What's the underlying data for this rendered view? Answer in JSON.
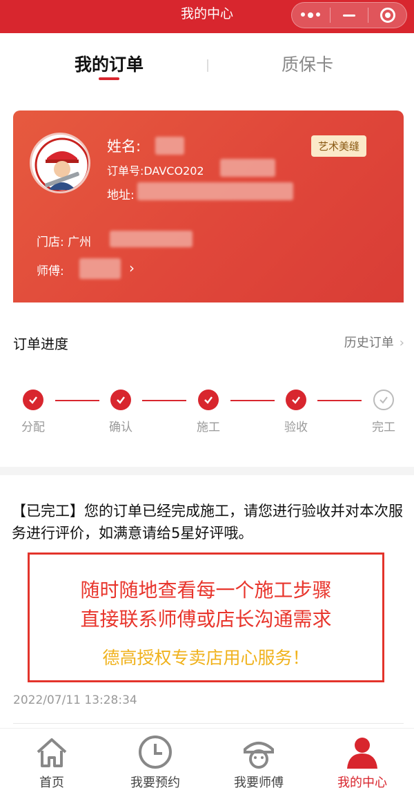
{
  "topbar": {
    "title": "我的中心"
  },
  "tabs": {
    "active": "我的订单",
    "inactive": "质保卡"
  },
  "card": {
    "name_label": "姓名:",
    "order_label": "订单号:DAVCO202",
    "address_label": "地址:",
    "tag": "艺术美缝",
    "store_label": "门店:  广州",
    "master_label": "师傅:"
  },
  "progress": {
    "title": "订单进度",
    "history": "历史订单",
    "steps": [
      "分配",
      "确认",
      "施工",
      "验收",
      "完工"
    ]
  },
  "message": {
    "text": "【已完工】您的订单已经完成施工，请您进行验收并对本次服务进行评价，如满意请给5星好评哦。",
    "promo_line1": "随时随地查看每一个施工步骤",
    "promo_line2": "直接联系师傅或店长沟通需求",
    "promo_line3": "德高授权专卖店用心服务！",
    "timestamp": "2022/07/11 13:28:34"
  },
  "tabbar": {
    "home": "首页",
    "booking": "我要预约",
    "master": "我要师傅",
    "center": "我的中心"
  },
  "colors": {
    "brand_red": "#d8262e",
    "promo_yellow": "#f0b21c"
  }
}
